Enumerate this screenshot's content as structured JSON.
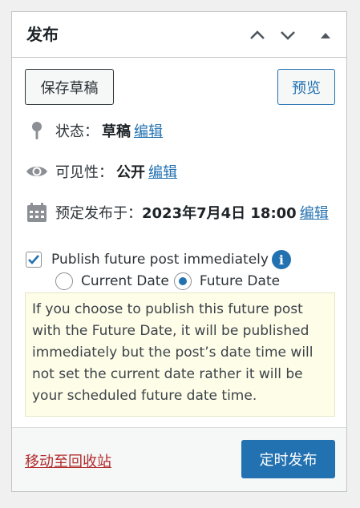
{
  "header": {
    "title": "发布",
    "icons": [
      "chevron-up-icon",
      "chevron-down-icon",
      "triangle-up-icon"
    ]
  },
  "actions": {
    "save_draft": "保存草稿",
    "preview": "预览"
  },
  "status": {
    "label": "状态：",
    "value": "草稿",
    "edit": "编辑",
    "icon": "pin-icon"
  },
  "visibility": {
    "label": "可见性：",
    "value": "公开",
    "edit": "编辑",
    "icon": "eye-icon"
  },
  "schedule": {
    "label": "预定发布于：",
    "value": "2023年7月4日 18:00",
    "edit": "编辑",
    "icon": "calendar-icon"
  },
  "publish_option": {
    "checkbox_label": "Publish future post immediately",
    "checked": true,
    "info_icon": "info-icon",
    "radios": [
      {
        "label": "Current Date",
        "selected": false
      },
      {
        "label": "Future Date",
        "selected": true
      }
    ]
  },
  "notice": {
    "text": "If you choose to publish this future post with the Future Date, it will be published immediately but the post’s date time will not set the current date rather it will be your scheduled future date time."
  },
  "footer": {
    "trash": "移动至回收站",
    "publish": "定时发布"
  },
  "colors": {
    "accent": "#2271b1",
    "danger": "#b32d2e",
    "notice_bg": "#fefde8"
  }
}
